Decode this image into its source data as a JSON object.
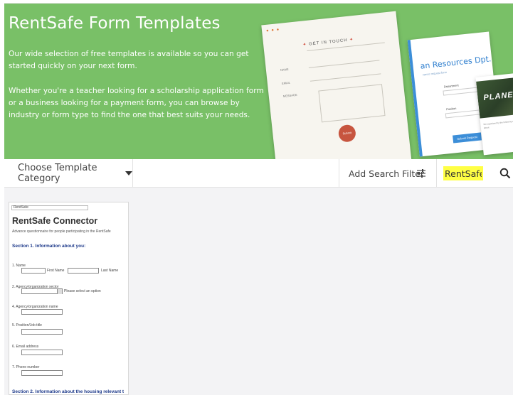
{
  "hero": {
    "title": "RentSafe Form Templates",
    "paragraph1": "Our wide selection of free templates is available so you can get started quickly on your next form.",
    "paragraph2": "Whether you're a teacher looking for a scholarship application form or a business looking for a payment form, you can browse by industry or form type to find the one that best suits your needs.",
    "illustration": {
      "contact_heading": "GET IN TOUCH",
      "contact_fields": [
        "NAME",
        "EMAIL",
        "MESSAGE"
      ],
      "contact_submit": "Submit",
      "hr_title": "an Resources Dpt.",
      "hr_subtitle": "vance request form",
      "hr_field1": "Department",
      "hr_field2": "Position",
      "hr_button": "Submit Request",
      "planet_title": "PLANET",
      "planet_text": "We organized by the following and sharing about"
    }
  },
  "toolbar": {
    "category_label": "Choose Template Category",
    "filter_label": "Add Search Filter",
    "search_value": "RentSafe"
  },
  "template_card": {
    "brand": "RentSafe",
    "title": "RentSafe Connector",
    "description": "Advance questionnaire for people participating in the RentSafe",
    "section1": "Section 1. Information about you:",
    "q1": "1. Name",
    "q1_first": "First Name",
    "q1_last": "Last Name",
    "q2": "2. Agency/organization sector",
    "q2_hint": "Please select an option",
    "q4": "4. Agency/organization name",
    "q5": "5. Position/Job title",
    "q6": "6. Email address",
    "q7": "7. Phone number",
    "section2": "Section 2. Information about the housing relevant t"
  },
  "colors": {
    "hero_green": "#79c067",
    "search_highlight": "#ffff44",
    "section_blue": "#1e3a8a"
  }
}
